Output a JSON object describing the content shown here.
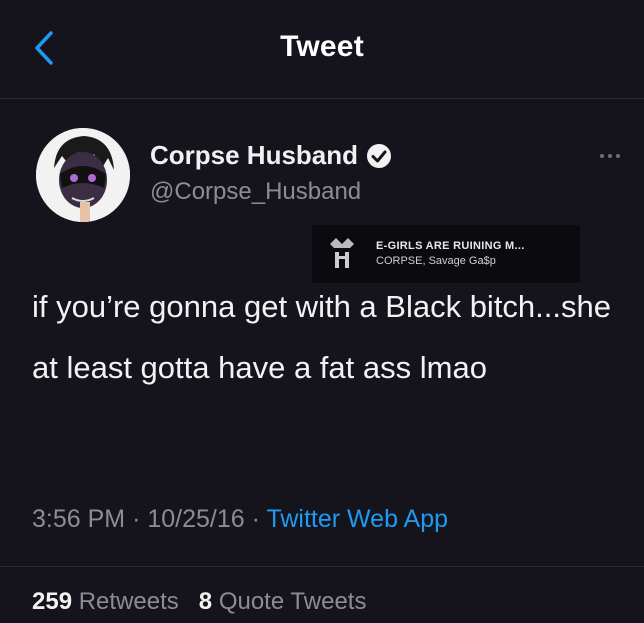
{
  "header": {
    "title": "Tweet",
    "back_icon": "chevron-left-icon"
  },
  "user": {
    "display_name": "Corpse Husband",
    "handle": "@Corpse_Husband",
    "verified_icon": "verified-badge-icon"
  },
  "music_overlay": {
    "title": "E-GIRLS ARE RUINING M...",
    "artist": "CORPSE, Savage Ga$p"
  },
  "tweet": {
    "text": "if you’re gonna get with a Black bitch...she at least gotta have a fat ass lmao",
    "time": "3:56 PM",
    "date": "10/25/16",
    "source": "Twitter Web App"
  },
  "stats": {
    "retweets_count": "259",
    "retweets_label": "Retweets",
    "quotes_count": "8",
    "quotes_label": "Quote Tweets"
  },
  "colors": {
    "background": "#15141d",
    "link": "#1d9bf0",
    "muted": "#8a8d93"
  }
}
